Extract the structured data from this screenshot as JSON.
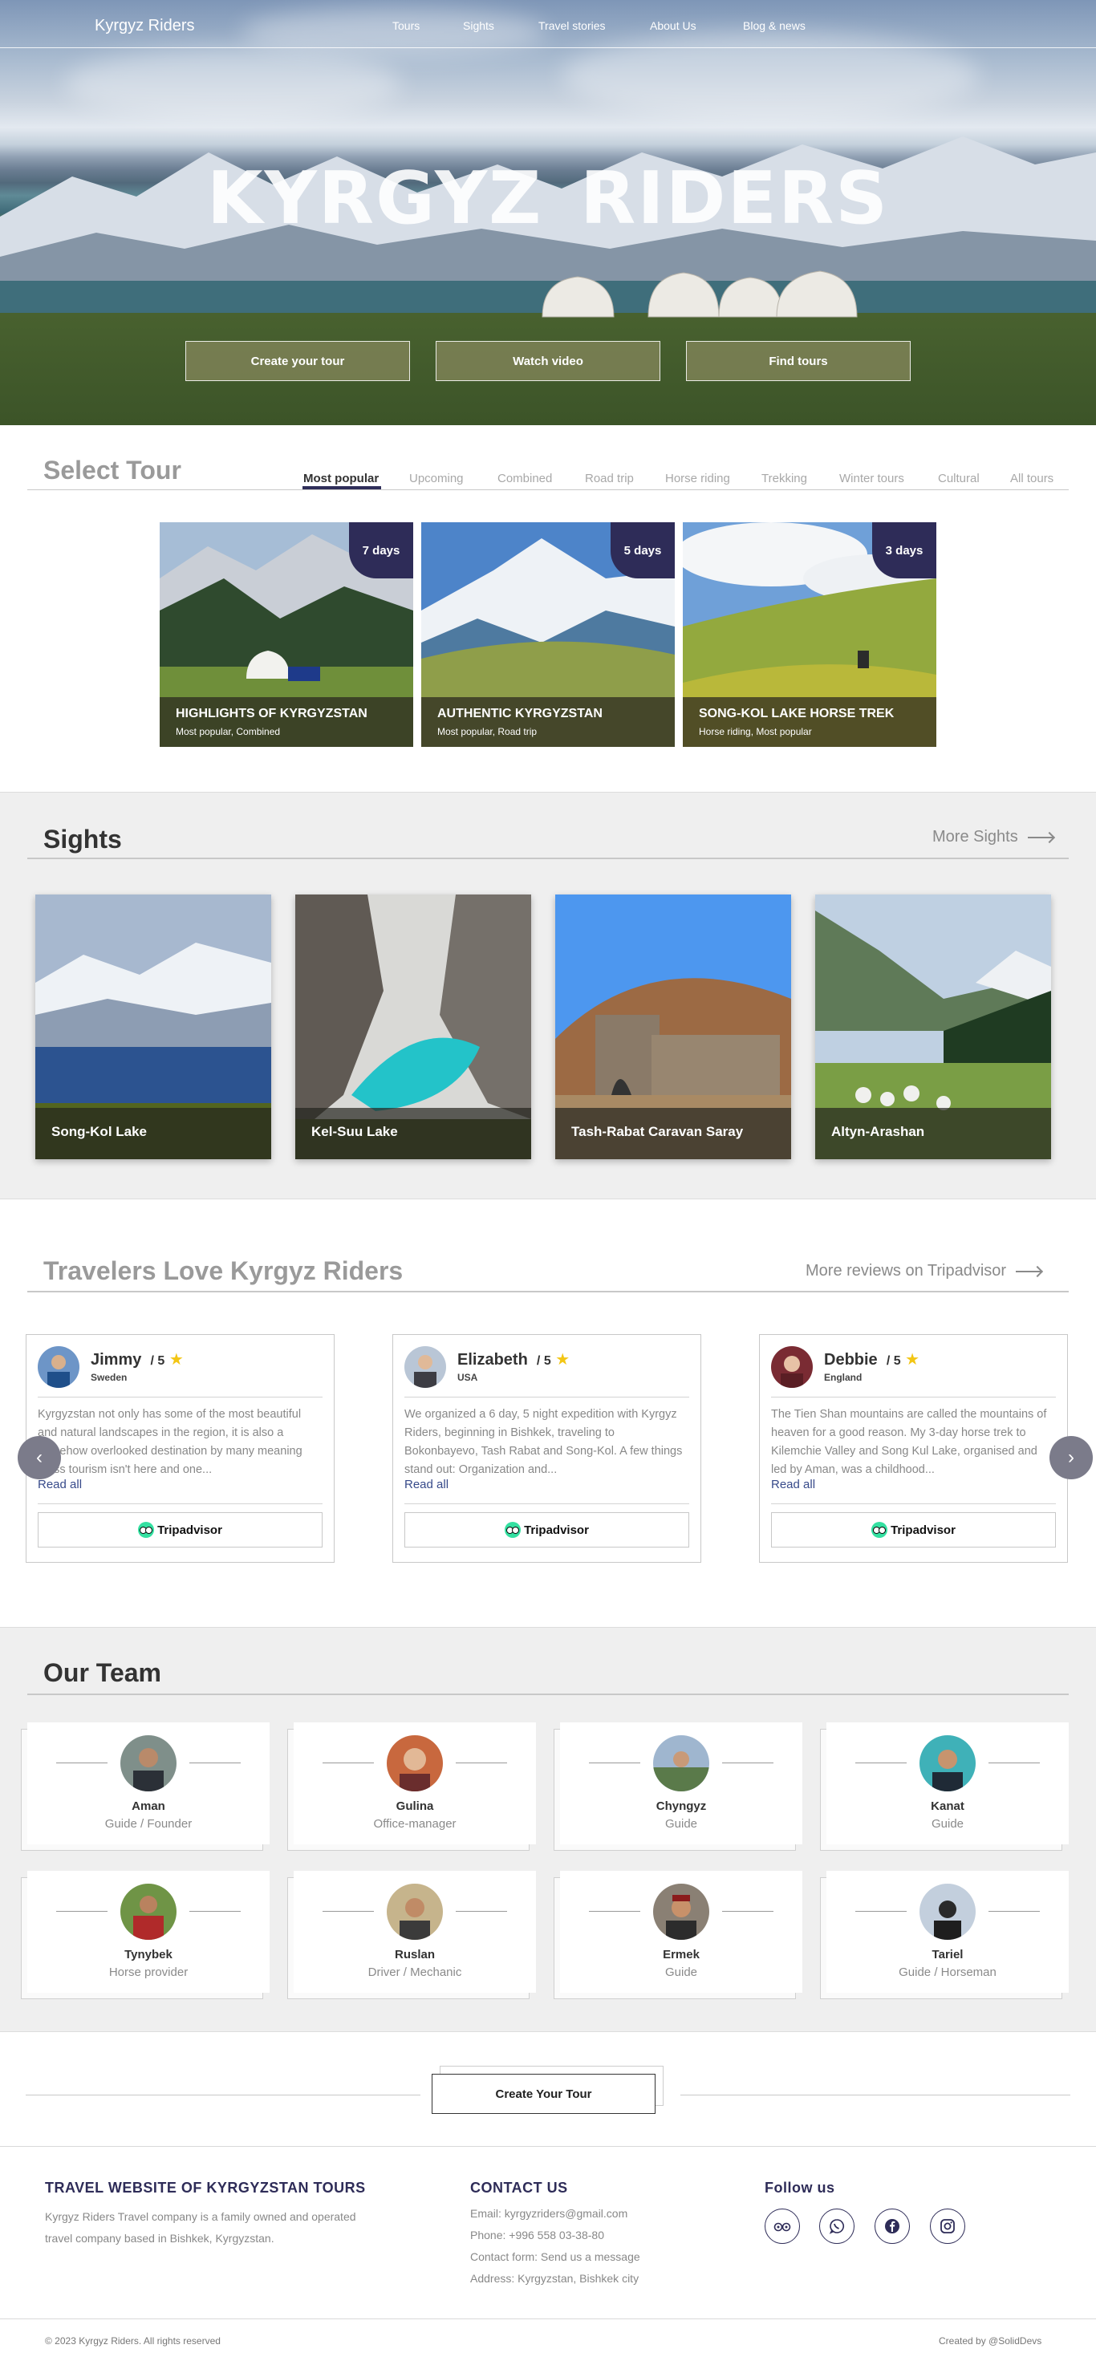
{
  "header": {
    "brand": "Kyrgyz Riders",
    "nav": [
      "Tours",
      "Sights",
      "Travel stories",
      "About Us",
      "Blog & news"
    ]
  },
  "hero": {
    "title": "Kyrgyz riders",
    "buttons": [
      "Create your tour",
      "Watch video",
      "Find tours"
    ]
  },
  "select_tour": {
    "title": "Select Tour",
    "tabs": [
      "Most popular",
      "Upcoming",
      "Combined",
      "Road trip",
      "Horse riding",
      "Trekking",
      "Winter tours",
      "Cultural",
      "All tours"
    ],
    "active_tab": "Most popular",
    "tours": [
      {
        "days": "7 days",
        "name": "HIGHLIGHTS OF KYRGYZSTAN",
        "tags": "Most popular, Combined"
      },
      {
        "days": "5 days",
        "name": "AUTHENTIC KYRGYZSTAN",
        "tags": "Most popular, Road trip"
      },
      {
        "days": "3 days",
        "name": "SONG-KOL LAKE HORSE TREK",
        "tags": "Horse riding, Most popular"
      }
    ]
  },
  "sights": {
    "title": "Sights",
    "more": "More Sights",
    "items": [
      {
        "name": "Song-Kol Lake"
      },
      {
        "name": "Kel-Suu Lake"
      },
      {
        "name": "Tash-Rabat Caravan Saray"
      },
      {
        "name": "Altyn-Arashan"
      }
    ]
  },
  "reviews": {
    "title": "Travelers Love Kyrgyz Riders",
    "more": "More reviews on Tripadvisor",
    "read_all": "Read all",
    "tripadvisor": "Tripadvisor",
    "prev": "‹",
    "next": "›",
    "items": [
      {
        "name": "Jimmy",
        "score": "/ 5",
        "star": "★",
        "country": "Sweden",
        "text": "Kyrgyzstan not only has some of the most beautiful and natural landscapes in the region, it is also a somehow overlooked destination by many meaning mass tourism isn't here and one..."
      },
      {
        "name": "Elizabeth",
        "score": "/ 5",
        "star": "★",
        "country": "USA",
        "text": "We organized a 6 day, 5 night expedition with Kyrgyz Riders, beginning in Bishkek, traveling to Bokonbayevo, Tash Rabat and Song-Kol. A few things stand out: Organization and..."
      },
      {
        "name": "Debbie",
        "score": "/ 5",
        "star": "★",
        "country": "England",
        "text": "The Tien Shan mountains are called the mountains of heaven for a good reason. My 3-day horse trek to Kilemchie Valley and Song Kul Lake, organised and led by Aman, was a childhood..."
      }
    ]
  },
  "team": {
    "title": "Our Team",
    "members": [
      {
        "name": "Aman",
        "role": "Guide / Founder"
      },
      {
        "name": "Gulina",
        "role": "Office-manager"
      },
      {
        "name": "Chyngyz",
        "role": "Guide"
      },
      {
        "name": "Kanat",
        "role": "Guide"
      },
      {
        "name": "Tynybek",
        "role": "Horse provider"
      },
      {
        "name": "Ruslan",
        "role": "Driver / Mechanic"
      },
      {
        "name": "Ermek",
        "role": "Guide"
      },
      {
        "name": "Tariel",
        "role": "Guide / Horseman"
      }
    ]
  },
  "cta": {
    "label": "Create Your Tour"
  },
  "footer": {
    "about_title": "TRAVEL WEBSITE OF KYRGYZSTAN TOURS",
    "about_text": "Kyrgyz Riders Travel company is a family owned and operated travel company based in Bishkek, Kyrgyzstan.",
    "contact_title": "CONTACT US",
    "contact": [
      "Email: kyrgyzriders@gmail.com",
      "Phone: +996 558 03-38-80",
      "Contact form: Send us a message",
      "Address: Kyrgyzstan, Bishkek city"
    ],
    "follow_title": "Follow us",
    "social_icons": [
      "tripadvisor-icon",
      "whatsapp-icon",
      "facebook-icon",
      "instagram-icon"
    ],
    "copyright": "© 2023 Kyrgyz Riders. All rights reserved",
    "credit": "Created by @SolidDevs"
  },
  "colors": {
    "accent": "#2e2c58",
    "hero_button": "#80845a",
    "star": "#f3c614",
    "tripadvisor": "#34e0a1"
  }
}
